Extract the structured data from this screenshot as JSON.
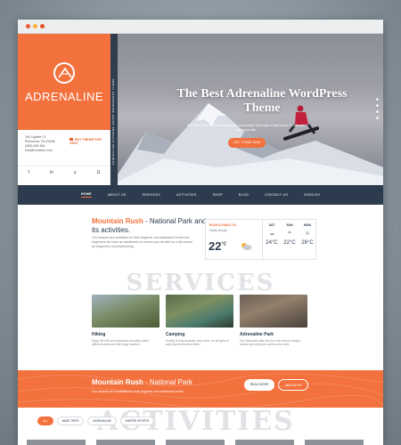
{
  "logo": {
    "name": "ADRENALINE"
  },
  "contact": {
    "lines": [
      "160 Ugalde Ct.",
      "Richmond, Pa 23156",
      "(463) 545 366",
      "info@ironaline.com"
    ],
    "buy_label": "BUY THEME FOR 100%"
  },
  "social": [
    "f",
    "in",
    "y",
    "G"
  ],
  "side_strip": "ADRENALINE EXTREME SPORT WORDPRESS THEME",
  "hero": {
    "title": "The Best Adrenaline WordPress Theme",
    "subtitle": "We have made the most advanced, comfortable and easy to use theme to help you build your site",
    "button": "GET THEME NOW"
  },
  "nav": [
    "HOME",
    "ABOUT US",
    "SERVICES",
    "ACTIVITIES",
    "SHOP",
    "BLOG",
    "CONTACT US",
    "ENGLISH"
  ],
  "intro": {
    "title_bold": "Mountain Rush",
    "title_rest": " - National Park and its activities.",
    "text": "Our lessons are available for both beginner and advanced levels: the beginners we have an assistance to ensure you as well as a full course for beginners mountaineering."
  },
  "weather": {
    "location": "RUSH ALPINES, US",
    "condition": "Partly cloudy",
    "temp": "22",
    "unit": "°C",
    "days": [
      {
        "name": "SAT",
        "temp": "24°C"
      },
      {
        "name": "SUN",
        "temp": "22°C"
      },
      {
        "name": "MON",
        "temp": "26°C"
      }
    ]
  },
  "services": {
    "heading": "SERVICES",
    "cards": [
      {
        "title": "Hiking",
        "text": "Enjoy the thrill and pleasures of surfing under different winds and with large swathes."
      },
      {
        "title": "Camping",
        "text": "Surfing is truly an active only worth, for all types of water sports but also effort."
      },
      {
        "title": "Adrenaline Park",
        "text": "Our instructors take you for a fun first run taught surfers and everyone surfers who need."
      }
    ]
  },
  "band": {
    "title_bold": "Mountain Rush",
    "title_rest": " - National Park",
    "text": "Our lessons are available for both beginner and advanced levels.",
    "buttons": [
      "READ MORE",
      "WATCH US"
    ]
  },
  "activities": {
    "heading": "ACTIVITIES",
    "filters": [
      "ALL",
      "BASE TRIPS",
      "ADRENALINE",
      "WINTER SPORTS"
    ]
  }
}
